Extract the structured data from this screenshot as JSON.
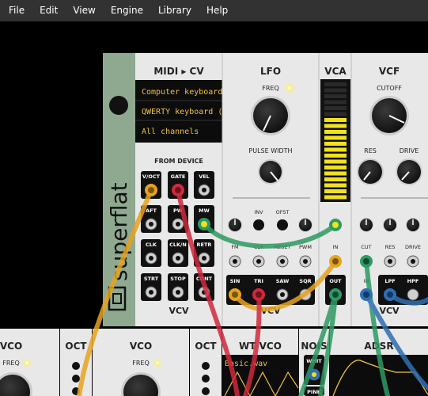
{
  "menu": {
    "file": "File",
    "edit": "Edit",
    "view": "View",
    "engine": "Engine",
    "library": "Library",
    "help": "Help"
  },
  "blank": {
    "brand": "superflat"
  },
  "midi": {
    "title": "MIDI ▸ CV",
    "driver": "Computer keyboard/m",
    "device": "QWERTY keyboard (U",
    "channel": "All channels",
    "from_device": "FROM DEVICE",
    "ports": {
      "voct": "V/OCT",
      "gate": "GATE",
      "vel": "VEL",
      "aft": "AFT",
      "pw": "PW",
      "mw": "MW",
      "clk": "CLK",
      "clkn": "CLK/N",
      "retr": "RETR",
      "strt": "STRT",
      "stop": "STOP",
      "cont": "CONT"
    },
    "logo": "VCV"
  },
  "lfo": {
    "title": "LFO",
    "freq": "FREQ",
    "pulse_width": "PULSE WIDTH",
    "inv": "INV",
    "ofst": "OFST",
    "fm": "FM",
    "clk": "CLK",
    "reset": "RESET",
    "pwm": "PWM",
    "sin": "SIN",
    "tri": "TRI",
    "saw": "SAW",
    "sqr": "SQR",
    "logo": "VCV"
  },
  "vca": {
    "title": "VCA",
    "in": "IN",
    "out": "OUT",
    "level": 0.7
  },
  "vcf": {
    "title": "VCF",
    "cutoff": "CUTOFF",
    "res": "RES",
    "drive": "DRIVE",
    "cut": "CUT",
    "res2": "RES",
    "drive2": "DRIVE",
    "in": "IN",
    "lpf": "LPF",
    "hpf": "HPF",
    "logo": "VCV"
  },
  "bottom": {
    "vco1": "VCO",
    "freq1": "FREQ",
    "oct1": "OCT",
    "vco2": "VCO",
    "freq2": "FREQ",
    "oct2": "OCT",
    "wtvco": "WT VCO",
    "wave_file": "Basic.wav",
    "nois": "NOIS",
    "whit": "WHIT",
    "pink": "PINK",
    "adsr": "ADSR"
  },
  "colors": {
    "cable_green": "#2e9a63",
    "cable_yellow": "#e6a21f",
    "cable_red": "#d0293d",
    "cable_blue": "#2f6fb3",
    "meter": "#f1e21b"
  }
}
